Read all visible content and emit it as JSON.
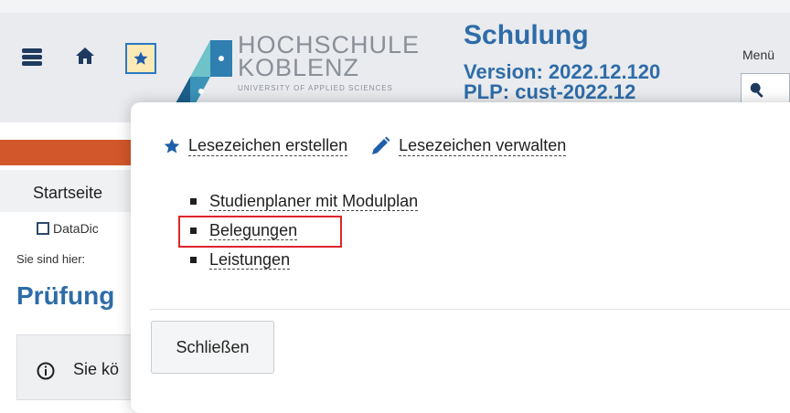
{
  "header": {
    "logo_line1": "HOCHSCHULE",
    "logo_line2": "KOBLENZ",
    "logo_sub": "UNIVERSITY OF APPLIED SCIENCES",
    "title": "Schulung",
    "version": "Version: 2022.12.120",
    "plp": "PLP: cust-2022.12",
    "menu_label": "Menü"
  },
  "nav": {
    "start": "Startseite",
    "datadict": "DataDic"
  },
  "page": {
    "breadcrumb": "Sie sind hier:",
    "title": "Prüfung",
    "info_text": "Sie kö"
  },
  "popover": {
    "create_bookmark": "Lesezeichen erstellen",
    "manage_bookmarks": "Lesezeichen verwalten",
    "bookmarks": [
      "Studienplaner mit Modulplan",
      "Belegungen",
      "Leistungen"
    ],
    "close_label": "Schließen"
  },
  "colors": {
    "accent_blue": "#2e6ca8",
    "orange_band": "#d2572a",
    "highlight_red": "#e0242b"
  }
}
